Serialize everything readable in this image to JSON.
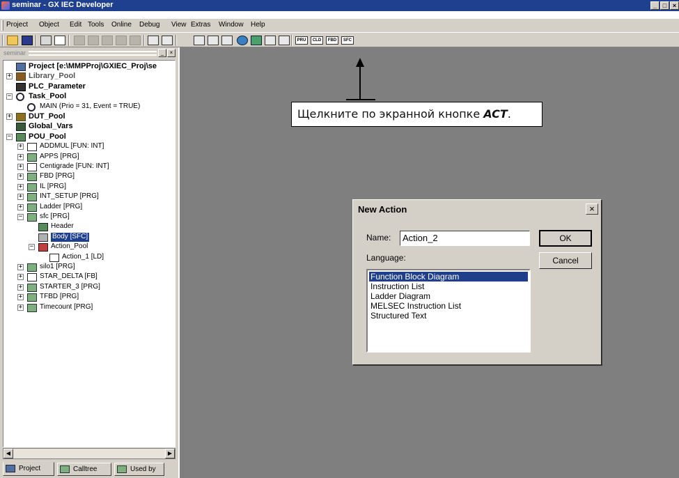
{
  "window": {
    "title": "seminar - GX IEC Developer",
    "min": "_",
    "max": "□",
    "close": "×"
  },
  "menu": [
    "Project",
    "Object",
    "Edit",
    "Tools",
    "Online",
    "Debug",
    "View",
    "Extras",
    "Window",
    "Help"
  ],
  "toolbar": {
    "lang_buttons": [
      "PRU",
      "CLD",
      "FBD",
      "SFC"
    ]
  },
  "panel": {
    "caption": "seminar",
    "min": "_",
    "close": "×"
  },
  "tree": [
    {
      "label": "Project [e:\\MMPProj\\GXIEC_Proj\\se",
      "cls": "big",
      "icon": "proj",
      "exp": ""
    },
    {
      "label": "Library_Pool",
      "cls": "big muted",
      "icon": "lib",
      "exp": "+"
    },
    {
      "label": "PLC_Parameter",
      "cls": "big",
      "icon": "plc",
      "exp": ""
    },
    {
      "label": "Task_Pool",
      "cls": "big",
      "icon": "task",
      "exp": "−"
    },
    {
      "label": "MAIN (Prio = 31, Event = TRUE)",
      "cls": "",
      "icon": "task",
      "exp": ""
    },
    {
      "label": "DUT_Pool",
      "cls": "big",
      "icon": "dut",
      "exp": "+"
    },
    {
      "label": "Global_Vars",
      "cls": "big",
      "icon": "gvar",
      "exp": ""
    },
    {
      "label": "POU_Pool",
      "cls": "big",
      "icon": "pou",
      "exp": "−"
    },
    {
      "label": "ADDMUL [FUN: INT]",
      "cls": "",
      "icon": "fun",
      "exp": "+"
    },
    {
      "label": "APPS [PRG]",
      "cls": "",
      "icon": "prg",
      "exp": "+"
    },
    {
      "label": "Centigrade [FUN: INT]",
      "cls": "",
      "icon": "fun",
      "exp": "+"
    },
    {
      "label": "FBD [PRG]",
      "cls": "",
      "icon": "prg",
      "exp": "+"
    },
    {
      "label": "IL [PRG]",
      "cls": "",
      "icon": "prg",
      "exp": "+"
    },
    {
      "label": "INT_SETUP [PRG]",
      "cls": "",
      "icon": "prg",
      "exp": "+"
    },
    {
      "label": "Ladder [PRG]",
      "cls": "",
      "icon": "prg",
      "exp": "+"
    },
    {
      "label": "sfc [PRG]",
      "cls": "",
      "icon": "prg",
      "exp": "−"
    },
    {
      "label": "Header",
      "cls": "",
      "icon": "hdr",
      "exp": ""
    },
    {
      "label": "Body [SFC]",
      "cls": "",
      "icon": "body",
      "exp": "",
      "selected": true
    },
    {
      "label": "Action_Pool",
      "cls": "",
      "icon": "apool",
      "exp": "−"
    },
    {
      "label": "Action_1 [LD]",
      "cls": "",
      "icon": "act",
      "exp": ""
    },
    {
      "label": "silo1 [PRG]",
      "cls": "",
      "icon": "prg",
      "exp": "+"
    },
    {
      "label": "STAR_DELTA [FB]",
      "cls": "",
      "icon": "fun",
      "exp": "+"
    },
    {
      "label": "STARTER_3 [PRG]",
      "cls": "",
      "icon": "prg",
      "exp": "+"
    },
    {
      "label": "TFBD [PRG]",
      "cls": "",
      "icon": "prg",
      "exp": "+"
    },
    {
      "label": "Timecount [PRG]",
      "cls": "",
      "icon": "prg",
      "exp": "+"
    }
  ],
  "tabs": [
    "Project",
    "Calltree",
    "Used by"
  ],
  "callout": {
    "text": "Щелкните по экранной кнопке ",
    "emph": "ACT",
    "tail": "."
  },
  "dialog": {
    "title": "New Action",
    "close": "×",
    "name_label": "Name:",
    "name_value": "Action_2",
    "language_label": "Language:",
    "languages": [
      "Function Block Diagram",
      "Instruction List",
      "Ladder Diagram",
      "MELSEC Instruction List",
      "Structured Text"
    ],
    "selected_language": "Function Block Diagram",
    "ok_label": "OK",
    "cancel_label": "Cancel"
  },
  "colors": {
    "title_bar": "#1f3f8f",
    "face": "#d4d0c8",
    "workspace": "#7f7f7f",
    "selection": "#1f3f8a"
  }
}
